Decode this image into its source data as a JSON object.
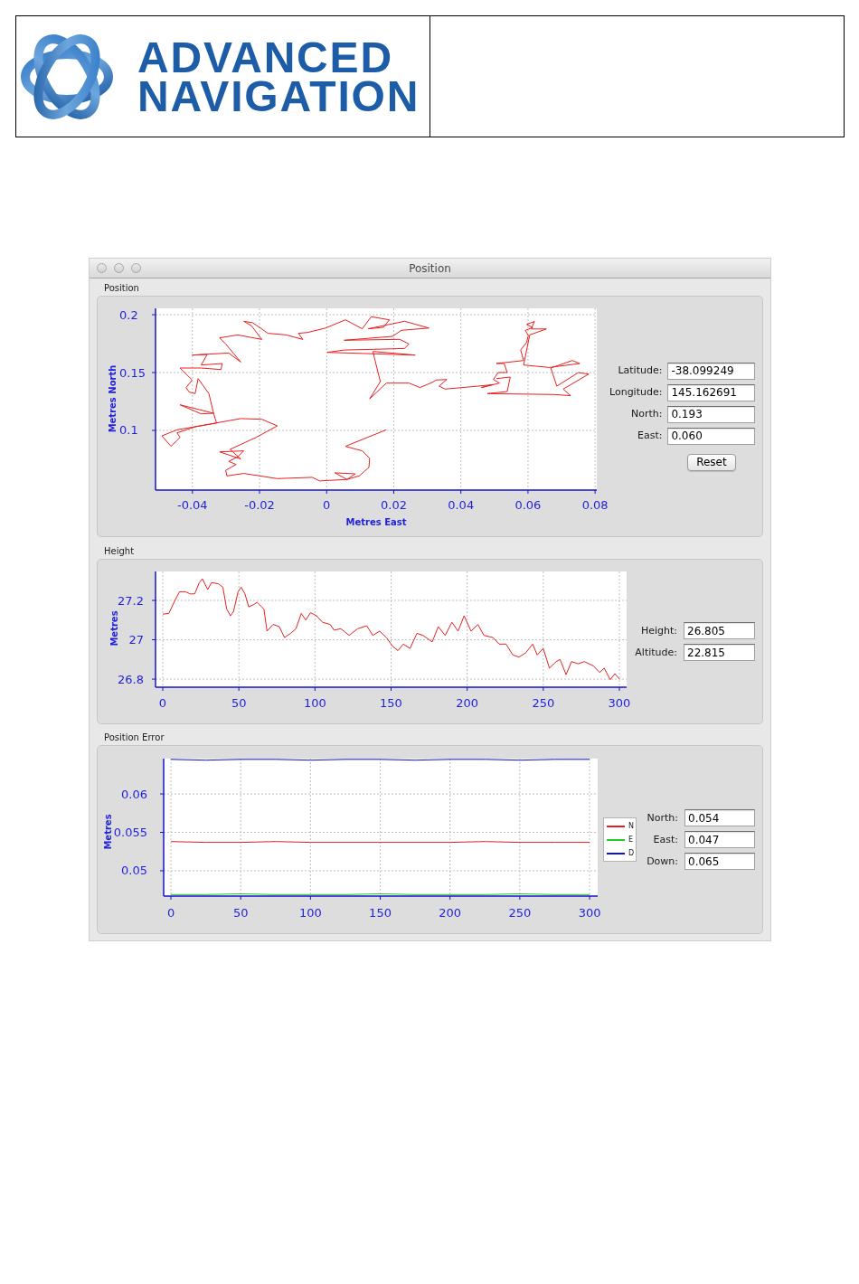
{
  "header": {
    "logo_lines": [
      "ADVANCED",
      "NAVIGATION"
    ]
  },
  "window": {
    "title": "Position"
  },
  "sections": [
    {
      "kind": "position",
      "label": "Position",
      "chart_data": {
        "type": "line",
        "grid": true,
        "xlabel": "Metres East",
        "ylabel": "Metres North",
        "x": [
          0.0178,
          0.0056,
          0.0106,
          0.0128,
          0.0126,
          0.0097,
          0.0061,
          0.0024,
          0.0085,
          0.0061,
          -0.0021,
          -0.0043,
          -0.0147,
          -0.0247,
          -0.0297,
          -0.0301,
          -0.027,
          -0.0292,
          -0.0265,
          -0.0247,
          -0.0319,
          -0.0256,
          -0.0288,
          -0.021,
          -0.0147,
          -0.0193,
          -0.0256,
          -0.0392,
          -0.0446,
          -0.0437,
          -0.0464,
          -0.0491,
          -0.0446,
          -0.0328,
          -0.0337,
          -0.0437,
          -0.0374,
          -0.0337,
          -0.0351,
          -0.0383,
          -0.0392,
          -0.041,
          -0.0419,
          -0.0401,
          -0.0437,
          -0.0374,
          -0.0315,
          -0.0311,
          -0.0374,
          -0.0356,
          -0.0401,
          -0.0292,
          -0.0256,
          -0.0301,
          -0.0319,
          -0.0265,
          -0.0193,
          -0.0224,
          -0.0247,
          -0.022,
          -0.0175,
          -0.012,
          -0.0071,
          -0.0084,
          -0.0057,
          -0.0003,
          0.0056,
          0.0106,
          0.0133,
          0.0187,
          0.0169,
          0.0124,
          0.0232,
          0.0305,
          0.0223,
          0.0196,
          0.0052,
          0.0218,
          0.0245,
          0.0232,
          0.0052,
          0.0002,
          0.0264,
          0.0138,
          0.0142,
          0.016,
          0.0128,
          0.0178,
          0.0246,
          0.0278,
          0.0314,
          0.0326,
          0.0358,
          0.0335,
          0.0353,
          0.0452,
          0.0497,
          0.0461,
          0.0515,
          0.0497,
          0.0511,
          0.0538,
          0.0529,
          0.0506,
          0.0587,
          0.0578,
          0.0596,
          0.0601,
          0.0592,
          0.0614,
          0.0596,
          0.0619,
          0.061,
          0.0655,
          0.0605,
          0.0587,
          0.0664,
          0.0754,
          0.0732,
          0.0668,
          0.0686,
          0.075,
          0.0781,
          0.0705,
          0.0727,
          0.0678,
          0.0479,
          0.0538,
          0.0547,
          0.0506
        ],
        "series": [
          {
            "color": "#e82020",
            "values": [
              0.1005,
              0.0862,
              0.0823,
              0.0758,
              0.068,
              0.0607,
              0.0576,
              0.0633,
              0.0625,
              0.0576,
              0.0563,
              0.0594,
              0.0583,
              0.0628,
              0.0607,
              0.0654,
              0.0706,
              0.0732,
              0.0771,
              0.0823,
              0.0815,
              0.0753,
              0.0836,
              0.094,
              0.1039,
              0.1096,
              0.1102,
              0.1031,
              0.0979,
              0.094,
              0.0862,
              0.0953,
              0.1005,
              0.1063,
              0.1148,
              0.1221,
              0.1143,
              0.1148,
              0.1318,
              0.1448,
              0.1318,
              0.1331,
              0.137,
              0.1435,
              0.1539,
              0.1539,
              0.1526,
              0.1578,
              0.1565,
              0.1656,
              0.1651,
              0.1669,
              0.1591,
              0.1747,
              0.18,
              0.1825,
              0.1786,
              0.1904,
              0.1943,
              0.193,
              0.1839,
              0.1825,
              0.1786,
              0.1839,
              0.1846,
              0.1885,
              0.1956,
              0.1878,
              0.1982,
              0.1956,
              0.1891,
              0.1878,
              0.1943,
              0.1885,
              0.1865,
              0.1813,
              0.1779,
              0.1787,
              0.1747,
              0.1708,
              0.1695,
              0.1674,
              0.1651,
              0.1682,
              0.163,
              0.1422,
              0.1273,
              0.1409,
              0.1409,
              0.137,
              0.1414,
              0.1435,
              0.144,
              0.1383,
              0.1357,
              0.1383,
              0.1396,
              0.137,
              0.1409,
              0.144,
              0.15,
              0.15,
              0.1578,
              0.1578,
              0.1604,
              0.1695,
              0.176,
              0.182,
              0.1864,
              0.189,
              0.1916,
              0.1942,
              0.1877,
              0.1877,
              0.1825,
              0.1565,
              0.1544,
              0.1578,
              0.1604,
              0.1539,
              0.1383,
              0.15,
              0.1487,
              0.1357,
              0.13,
              0.131,
              0.1318,
              0.1336,
              0.1461,
              0.1448
            ]
          }
        ],
        "xlim": [
          -0.051,
          0.0805
        ],
        "ylim": [
          0.0484,
          0.2055
        ],
        "xticks": [
          -0.04,
          -0.02,
          0,
          0.02,
          0.04,
          0.06,
          0.08
        ],
        "yticks": [
          0.1,
          0.15,
          0.2
        ]
      },
      "fields": [
        {
          "label": "Latitude:",
          "value": "-38.099249"
        },
        {
          "label": "Longitude:",
          "value": "145.162691"
        },
        {
          "label": "North:",
          "value": "0.193"
        },
        {
          "label": "East:",
          "value": "0.060"
        }
      ],
      "button": "Reset"
    },
    {
      "kind": "height",
      "label": "Height",
      "chart_data": {
        "type": "line",
        "grid": true,
        "ylabel": "Metres",
        "x": [
          0,
          4,
          8,
          11,
          15,
          18,
          21,
          24,
          26,
          29.5,
          32,
          36.5,
          39.5,
          42,
          44.5,
          46.5,
          49.5,
          51.5,
          54,
          56.5,
          59.5,
          62,
          66.5,
          68.5,
          72.5,
          76.5,
          80,
          84,
          87.5,
          91,
          94,
          97,
          101,
          105,
          110,
          112.5,
          117,
          122.5,
          128,
          134,
          138,
          142.5,
          147,
          151,
          154.5,
          158,
          162.5,
          167,
          171,
          177,
          181,
          185.5,
          190,
          194,
          198,
          202.5,
          207,
          211,
          217,
          221,
          225.5,
          230,
          234,
          238.5,
          243,
          246,
          250,
          254,
          258.5,
          261,
          265,
          268.5,
          273,
          277,
          283,
          287,
          290,
          294,
          297,
          300
        ],
        "series": [
          {
            "color": "#e82020",
            "values": [
              27.13,
              27.134,
              27.2,
              27.244,
              27.244,
              27.233,
              27.233,
              27.29,
              27.31,
              27.255,
              27.29,
              27.285,
              27.267,
              27.156,
              27.122,
              27.144,
              27.244,
              27.267,
              27.233,
              27.167,
              27.178,
              27.19,
              27.156,
              27.044,
              27.078,
              27.067,
              27.011,
              27.033,
              27.056,
              27.134,
              27.1,
              27.138,
              27.122,
              27.089,
              27.078,
              27.049,
              27.056,
              27.022,
              27.056,
              27.071,
              27.022,
              27.044,
              27.011,
              26.967,
              26.945,
              26.978,
              26.956,
              27.033,
              27.022,
              26.989,
              27.067,
              27.022,
              27.089,
              27.044,
              27.122,
              27.044,
              27.078,
              27.022,
              27.011,
              26.978,
              26.978,
              26.923,
              26.912,
              26.934,
              26.978,
              26.923,
              26.956,
              26.856,
              26.889,
              26.9,
              26.823,
              26.889,
              26.878,
              26.889,
              26.867,
              26.834,
              26.856,
              26.797,
              26.828,
              26.801
            ]
          }
        ],
        "xlim": [
          -4.75,
          304.75
        ],
        "ylim": [
          26.759,
          27.347
        ],
        "xticks": [
          0,
          50,
          100,
          150,
          200,
          250,
          300
        ],
        "yticks": [
          26.8,
          27,
          27.2
        ]
      },
      "fields": [
        {
          "label": "Height:",
          "value": "26.805"
        },
        {
          "label": "Altitude:",
          "value": "22.815"
        }
      ]
    },
    {
      "kind": "error",
      "label": "Position Error",
      "chart_data": {
        "type": "line",
        "grid": true,
        "legend": "right",
        "ylabel": "Metres",
        "x": [
          0,
          25,
          50,
          75,
          100,
          125,
          150,
          175,
          200,
          225,
          250,
          275,
          300
        ],
        "series": [
          {
            "name": "N",
            "color": "#e02020",
            "values": [
              0.0538,
              0.0537,
              0.0537,
              0.0538,
              0.0537,
              0.0537,
              0.0537,
              0.0537,
              0.0537,
              0.0538,
              0.0537,
              0.0537,
              0.0537
            ]
          },
          {
            "name": "E",
            "color": "#22cc22",
            "values": [
              0.0469,
              0.0469,
              0.047,
              0.0469,
              0.0469,
              0.0469,
              0.047,
              0.0469,
              0.0469,
              0.0469,
              0.047,
              0.0469,
              0.0469
            ]
          },
          {
            "name": "D",
            "color": "#1010d0",
            "values": [
              0.0645,
              0.0644,
              0.0645,
              0.0645,
              0.0644,
              0.0645,
              0.0645,
              0.0644,
              0.0645,
              0.0645,
              0.0644,
              0.0645,
              0.0645
            ]
          }
        ],
        "xlim": [
          -5.2,
          305.8
        ],
        "ylim": [
          0.0467,
          0.0646
        ],
        "xticks": [
          0,
          50,
          100,
          150,
          200,
          250,
          300
        ],
        "yticks": [
          0.05,
          0.055,
          0.06
        ]
      },
      "fields": [
        {
          "label": "North:",
          "value": "0.054"
        },
        {
          "label": "East:",
          "value": "0.047"
        },
        {
          "label": "Down:",
          "value": "0.065"
        }
      ]
    }
  ]
}
